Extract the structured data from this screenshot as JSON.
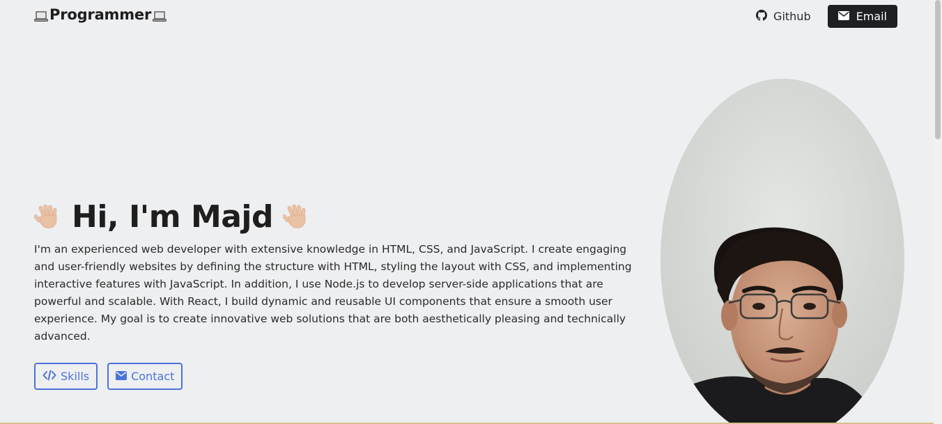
{
  "navbar": {
    "brand": "Programmer",
    "github_label": "Github",
    "email_label": "Email"
  },
  "hero": {
    "title": "Hi, I'm Majd",
    "description": "I'm an experienced web developer with extensive knowledge in HTML, CSS, and JavaScript. I create engaging and user-friendly websites by defining the structure with HTML, styling the layout with CSS, and implementing interactive features with JavaScript. In addition, I use Node.js to develop server-side applications that are powerful and scalable. With React, I build dynamic and reusable UI components that ensure a smooth user experience. My goal is to create innovative web solutions that are both aesthetically pleasing and technically advanced.",
    "skills_label": "Skills",
    "contact_label": "Contact"
  },
  "icons": {
    "brand_left": "laptop-icon",
    "brand_right": "laptop-icon",
    "github": "github-icon",
    "email": "envelope-icon",
    "wave": "waving-hand-icon",
    "skills": "code-icon",
    "contact": "envelope-icon"
  },
  "colors": {
    "background": "#eeeff1",
    "accent": "#4a72d9",
    "email_button": "#1f2022",
    "text": "#212529"
  }
}
